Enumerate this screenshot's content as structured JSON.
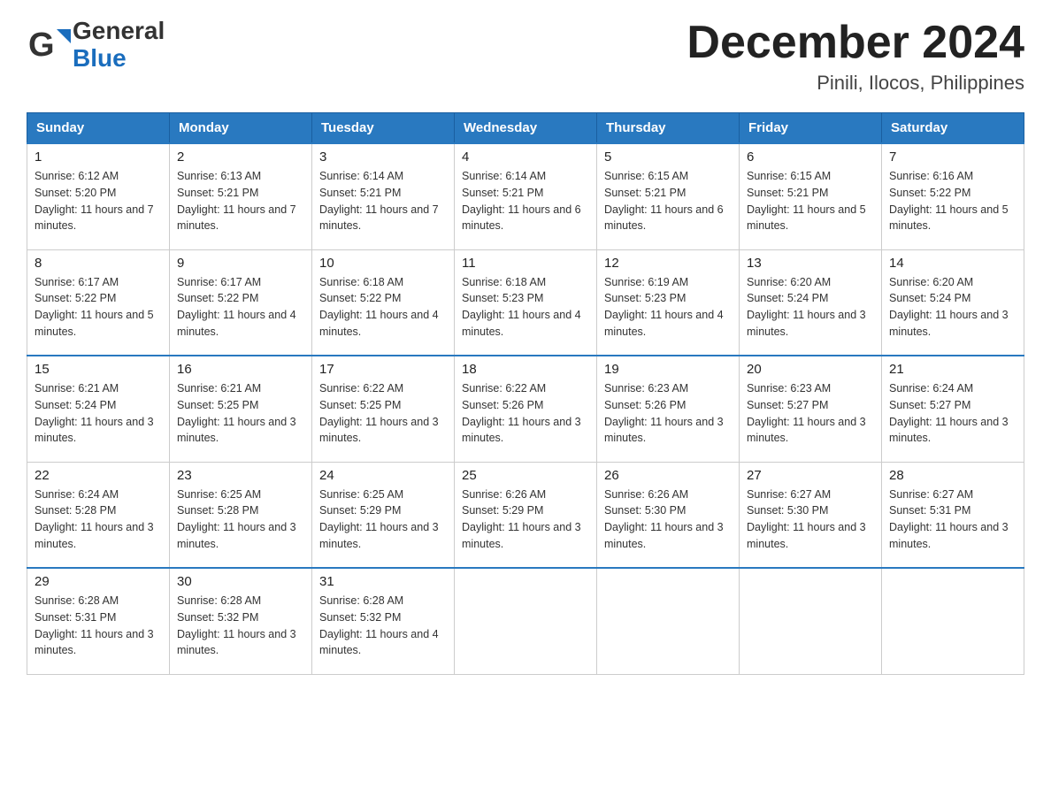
{
  "header": {
    "logo_general": "General",
    "logo_blue": "Blue",
    "month_title": "December 2024",
    "location": "Pinili, Ilocos, Philippines"
  },
  "days_of_week": [
    "Sunday",
    "Monday",
    "Tuesday",
    "Wednesday",
    "Thursday",
    "Friday",
    "Saturday"
  ],
  "weeks": [
    [
      {
        "day": "1",
        "sunrise": "6:12 AM",
        "sunset": "5:20 PM",
        "daylight": "11 hours and 7 minutes."
      },
      {
        "day": "2",
        "sunrise": "6:13 AM",
        "sunset": "5:21 PM",
        "daylight": "11 hours and 7 minutes."
      },
      {
        "day": "3",
        "sunrise": "6:14 AM",
        "sunset": "5:21 PM",
        "daylight": "11 hours and 7 minutes."
      },
      {
        "day": "4",
        "sunrise": "6:14 AM",
        "sunset": "5:21 PM",
        "daylight": "11 hours and 6 minutes."
      },
      {
        "day": "5",
        "sunrise": "6:15 AM",
        "sunset": "5:21 PM",
        "daylight": "11 hours and 6 minutes."
      },
      {
        "day": "6",
        "sunrise": "6:15 AM",
        "sunset": "5:21 PM",
        "daylight": "11 hours and 5 minutes."
      },
      {
        "day": "7",
        "sunrise": "6:16 AM",
        "sunset": "5:22 PM",
        "daylight": "11 hours and 5 minutes."
      }
    ],
    [
      {
        "day": "8",
        "sunrise": "6:17 AM",
        "sunset": "5:22 PM",
        "daylight": "11 hours and 5 minutes."
      },
      {
        "day": "9",
        "sunrise": "6:17 AM",
        "sunset": "5:22 PM",
        "daylight": "11 hours and 4 minutes."
      },
      {
        "day": "10",
        "sunrise": "6:18 AM",
        "sunset": "5:22 PM",
        "daylight": "11 hours and 4 minutes."
      },
      {
        "day": "11",
        "sunrise": "6:18 AM",
        "sunset": "5:23 PM",
        "daylight": "11 hours and 4 minutes."
      },
      {
        "day": "12",
        "sunrise": "6:19 AM",
        "sunset": "5:23 PM",
        "daylight": "11 hours and 4 minutes."
      },
      {
        "day": "13",
        "sunrise": "6:20 AM",
        "sunset": "5:24 PM",
        "daylight": "11 hours and 3 minutes."
      },
      {
        "day": "14",
        "sunrise": "6:20 AM",
        "sunset": "5:24 PM",
        "daylight": "11 hours and 3 minutes."
      }
    ],
    [
      {
        "day": "15",
        "sunrise": "6:21 AM",
        "sunset": "5:24 PM",
        "daylight": "11 hours and 3 minutes."
      },
      {
        "day": "16",
        "sunrise": "6:21 AM",
        "sunset": "5:25 PM",
        "daylight": "11 hours and 3 minutes."
      },
      {
        "day": "17",
        "sunrise": "6:22 AM",
        "sunset": "5:25 PM",
        "daylight": "11 hours and 3 minutes."
      },
      {
        "day": "18",
        "sunrise": "6:22 AM",
        "sunset": "5:26 PM",
        "daylight": "11 hours and 3 minutes."
      },
      {
        "day": "19",
        "sunrise": "6:23 AM",
        "sunset": "5:26 PM",
        "daylight": "11 hours and 3 minutes."
      },
      {
        "day": "20",
        "sunrise": "6:23 AM",
        "sunset": "5:27 PM",
        "daylight": "11 hours and 3 minutes."
      },
      {
        "day": "21",
        "sunrise": "6:24 AM",
        "sunset": "5:27 PM",
        "daylight": "11 hours and 3 minutes."
      }
    ],
    [
      {
        "day": "22",
        "sunrise": "6:24 AM",
        "sunset": "5:28 PM",
        "daylight": "11 hours and 3 minutes."
      },
      {
        "day": "23",
        "sunrise": "6:25 AM",
        "sunset": "5:28 PM",
        "daylight": "11 hours and 3 minutes."
      },
      {
        "day": "24",
        "sunrise": "6:25 AM",
        "sunset": "5:29 PM",
        "daylight": "11 hours and 3 minutes."
      },
      {
        "day": "25",
        "sunrise": "6:26 AM",
        "sunset": "5:29 PM",
        "daylight": "11 hours and 3 minutes."
      },
      {
        "day": "26",
        "sunrise": "6:26 AM",
        "sunset": "5:30 PM",
        "daylight": "11 hours and 3 minutes."
      },
      {
        "day": "27",
        "sunrise": "6:27 AM",
        "sunset": "5:30 PM",
        "daylight": "11 hours and 3 minutes."
      },
      {
        "day": "28",
        "sunrise": "6:27 AM",
        "sunset": "5:31 PM",
        "daylight": "11 hours and 3 minutes."
      }
    ],
    [
      {
        "day": "29",
        "sunrise": "6:28 AM",
        "sunset": "5:31 PM",
        "daylight": "11 hours and 3 minutes."
      },
      {
        "day": "30",
        "sunrise": "6:28 AM",
        "sunset": "5:32 PM",
        "daylight": "11 hours and 3 minutes."
      },
      {
        "day": "31",
        "sunrise": "6:28 AM",
        "sunset": "5:32 PM",
        "daylight": "11 hours and 4 minutes."
      },
      null,
      null,
      null,
      null
    ]
  ]
}
